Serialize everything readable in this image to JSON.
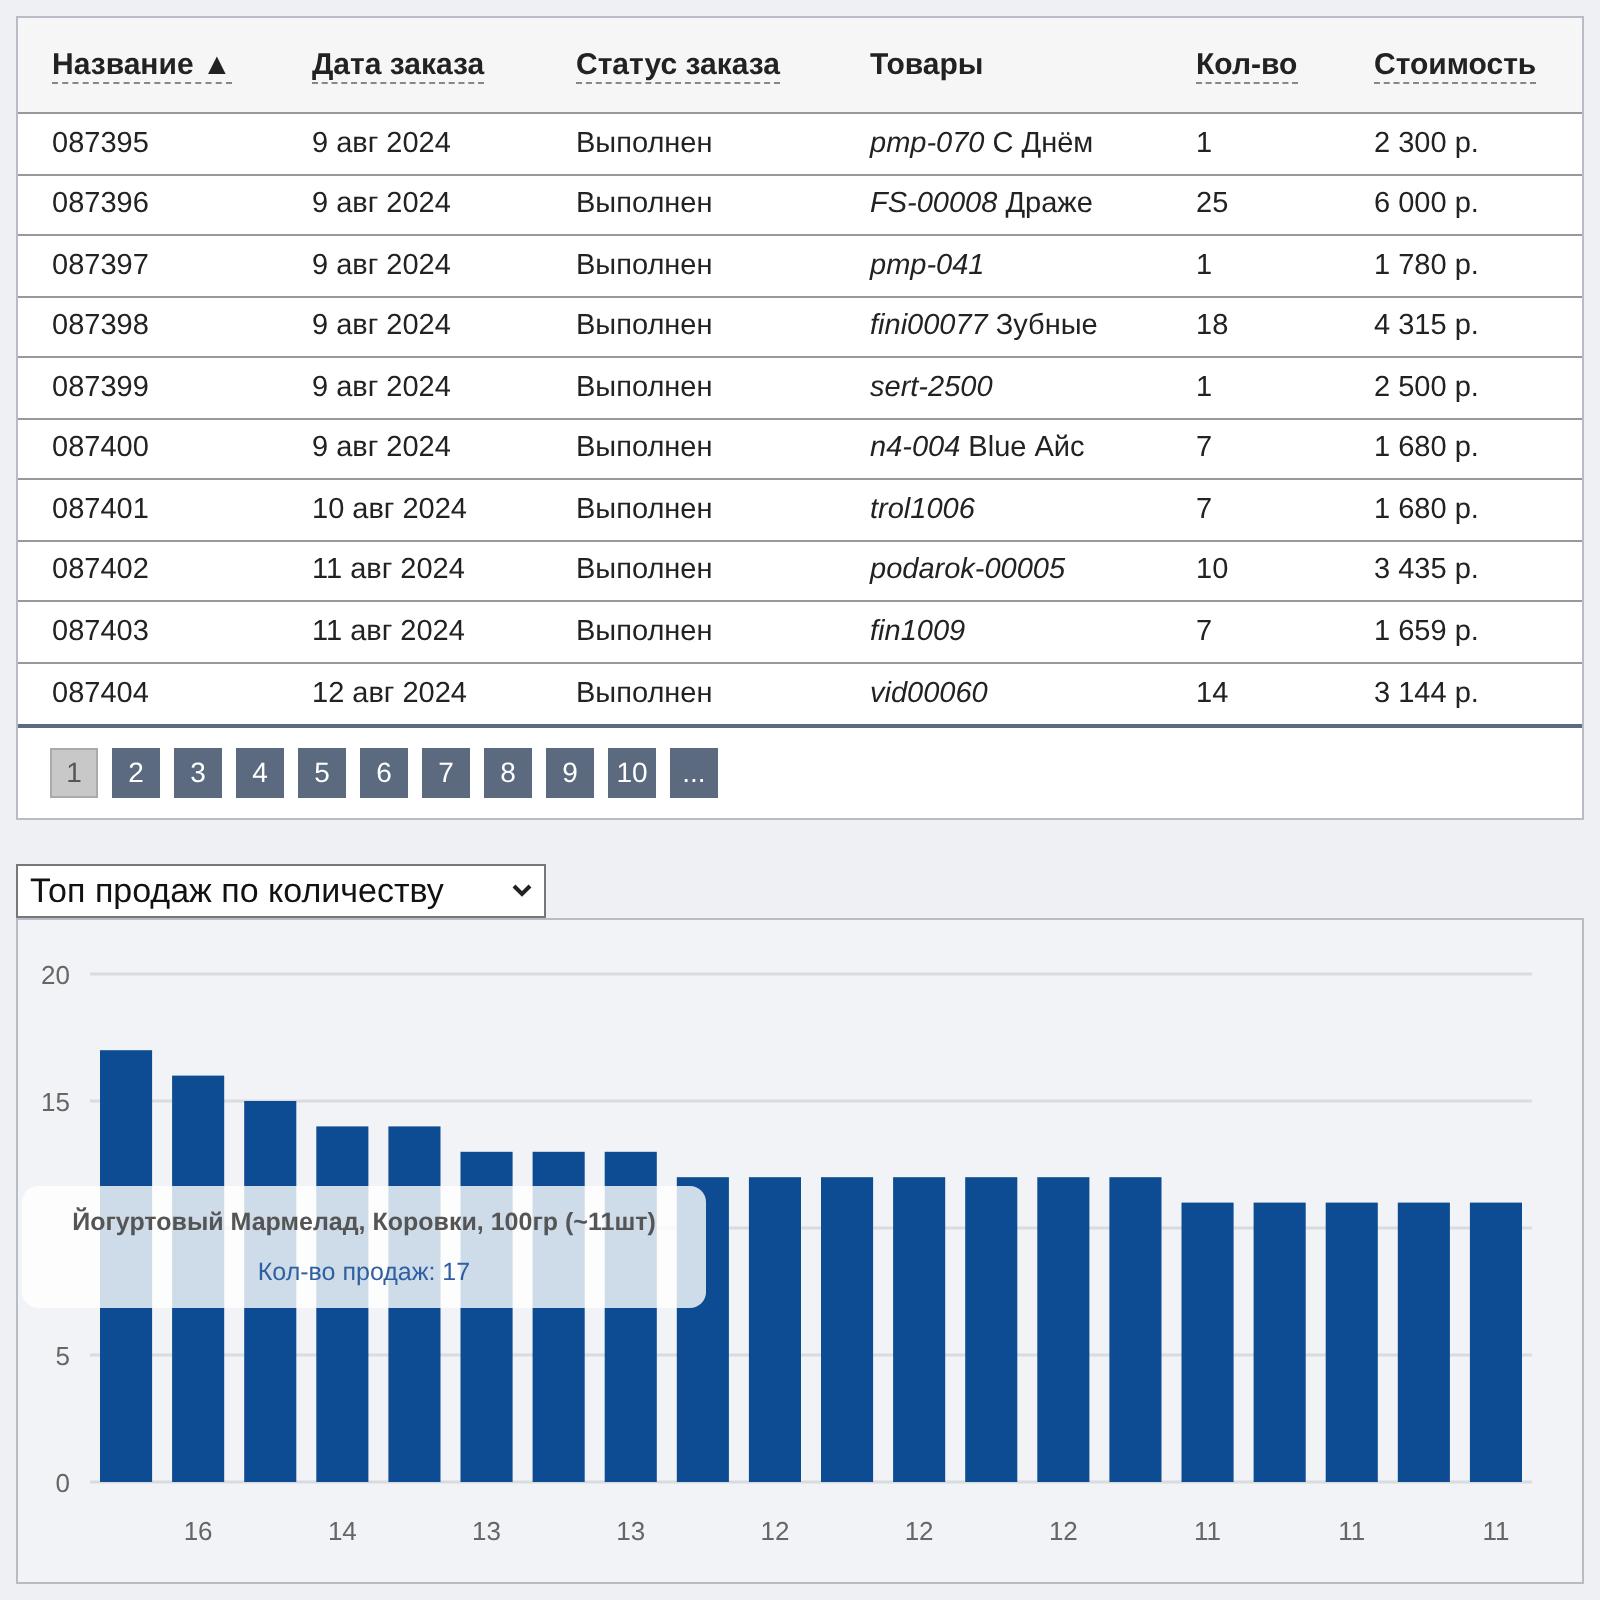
{
  "table": {
    "columns": [
      {
        "label": "Название ▲",
        "sortable": true
      },
      {
        "label": "Дата заказа",
        "sortable": true
      },
      {
        "label": "Статус заказа",
        "sortable": true
      },
      {
        "label": "Товары",
        "sortable": false
      },
      {
        "label": "Кол-во",
        "sortable": true
      },
      {
        "label": "Стоимость",
        "sortable": true
      }
    ],
    "rows": [
      [
        "087395",
        "9 авг 2024",
        "Выполнен",
        "*pmp-070* С Днём",
        "1",
        "2 300 р."
      ],
      [
        "087396",
        "9 авг 2024",
        "Выполнен",
        "*FS-00008* Драже",
        "25",
        "6 000 р."
      ],
      [
        "087397",
        "9 авг 2024",
        "Выполнен",
        "*pmp-041*",
        "1",
        "1 780 р."
      ],
      [
        "087398",
        "9 авг 2024",
        "Выполнен",
        "*fini00077* Зубные",
        "18",
        "4 315 р."
      ],
      [
        "087399",
        "9 авг 2024",
        "Выполнен",
        "*sert-2500*",
        "1",
        "2 500 р."
      ],
      [
        "087400",
        "9 авг 2024",
        "Выполнен",
        "*n4-004* Blue Айс",
        "7",
        "1 680 р."
      ],
      [
        "087401",
        "10 авг 2024",
        "Выполнен",
        "*trol1006*",
        "7",
        "1 680 р."
      ],
      [
        "087402",
        "11 авг 2024",
        "Выполнен",
        "*podarok-00005*",
        "10",
        "3 435 р."
      ],
      [
        "087403",
        "11 авг 2024",
        "Выполнен",
        "*fin1009*",
        "7",
        "1 659 р."
      ],
      [
        "087404",
        "12 авг 2024",
        "Выполнен",
        "*vid00060*",
        "14",
        "3 144 р."
      ]
    ]
  },
  "pagination": [
    {
      "label": "1",
      "selected": true
    },
    {
      "label": "2",
      "selected": false
    },
    {
      "label": "3",
      "selected": false
    },
    {
      "label": "4",
      "selected": false
    },
    {
      "label": "5",
      "selected": false
    },
    {
      "label": "6",
      "selected": false
    },
    {
      "label": "7",
      "selected": false
    },
    {
      "label": "8",
      "selected": false
    },
    {
      "label": "9",
      "selected": false
    },
    {
      "label": "10",
      "selected": false
    },
    {
      "label": "...",
      "selected": false
    }
  ],
  "chart_select": {
    "value": "Топ продаж по количеству"
  },
  "chart": {
    "chart_data": {
      "type": "bar",
      "values": [
        17,
        16,
        15,
        14,
        14,
        13,
        13,
        13,
        12,
        12,
        12,
        12,
        12,
        12,
        12,
        11,
        11,
        11,
        11,
        11
      ],
      "ylim": [
        0,
        20
      ],
      "yticks": [
        0,
        5,
        15,
        20
      ],
      "categories": [
        null,
        "16",
        null,
        "14",
        null,
        "13",
        null,
        "13",
        null,
        "12",
        null,
        "12",
        null,
        "12",
        null,
        "11",
        null,
        "11",
        null,
        "11"
      ]
    },
    "tooltip": {
      "title": "Йогуртовый Мармелад, Коровки, 100гр (~11шт)",
      "text": "Кол-во продаж: 17"
    }
  }
}
